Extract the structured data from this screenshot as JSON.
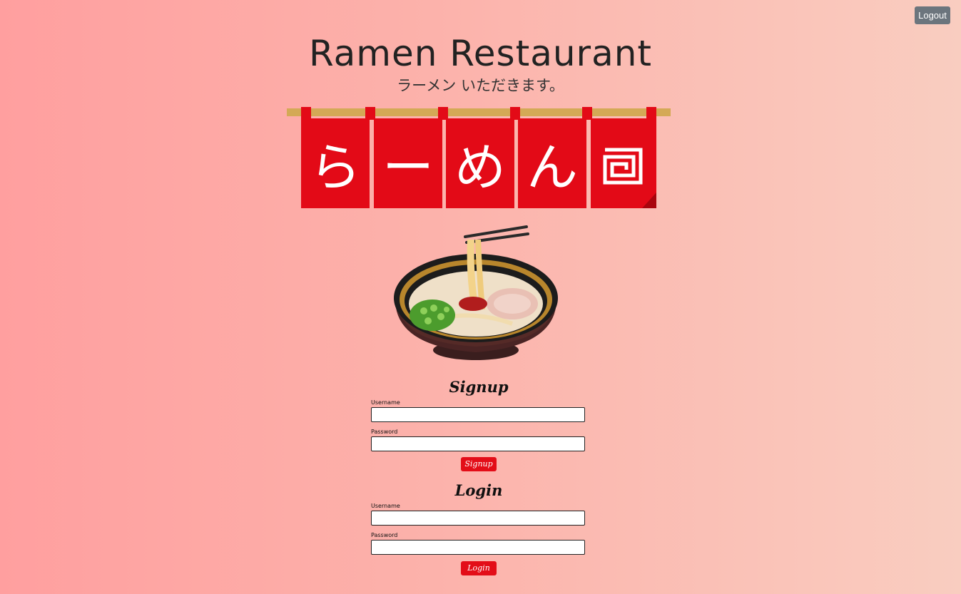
{
  "header": {
    "logout_label": "Logout",
    "title": "Ramen Restaurant",
    "subtitle": "ラーメン いただきます。"
  },
  "banner": {
    "characters": [
      "ら",
      "ー",
      "め",
      "ん"
    ],
    "icon": "spiral-square-icon",
    "colors": {
      "cloth": "#e30a17",
      "rod": "#d4a956",
      "text": "#ffffff"
    }
  },
  "signup": {
    "title": "Signup",
    "username_label": "Username",
    "username_value": "",
    "password_label": "Password",
    "password_value": "",
    "button_label": "Signup"
  },
  "login": {
    "title": "Login",
    "username_label": "Username",
    "username_value": "",
    "password_label": "Password",
    "password_value": "",
    "button_label": "Login"
  },
  "colors": {
    "background_start": "#ff9f9f",
    "background_end": "#f9cdc0",
    "accent_button": "#e30d18",
    "logout_button": "#6c757d"
  }
}
